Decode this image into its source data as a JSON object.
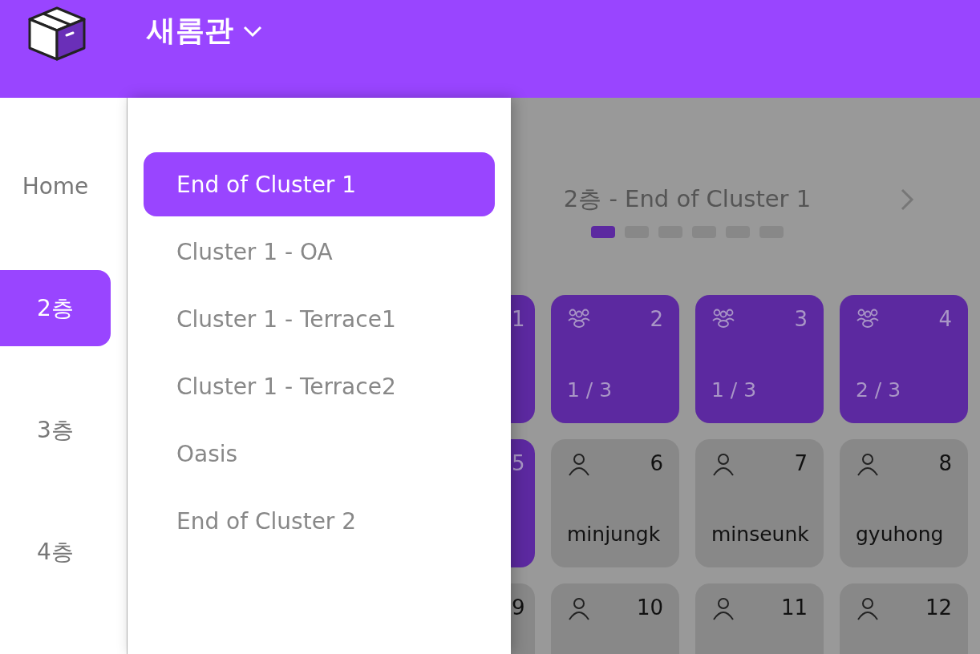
{
  "header": {
    "building": "새롬관"
  },
  "nav": {
    "items": [
      {
        "label": "Home",
        "selected": false
      },
      {
        "label": "2층",
        "selected": true
      },
      {
        "label": "3층",
        "selected": false
      },
      {
        "label": "4층",
        "selected": false
      }
    ]
  },
  "submenu": {
    "items": [
      {
        "label": "End of Cluster 1",
        "selected": true
      },
      {
        "label": "Cluster 1 - OA",
        "selected": false
      },
      {
        "label": "Cluster 1 - Terrace1",
        "selected": false
      },
      {
        "label": "Cluster 1 - Terrace2",
        "selected": false
      },
      {
        "label": "Oasis",
        "selected": false
      },
      {
        "label": "End of Cluster 2",
        "selected": false
      }
    ]
  },
  "page": {
    "title": "2층 - End of Cluster 1",
    "pages": [
      {
        "selected": true
      },
      {
        "selected": false
      },
      {
        "selected": false
      },
      {
        "selected": false
      },
      {
        "selected": false
      },
      {
        "selected": false
      }
    ]
  },
  "seats": [
    {
      "number": "1",
      "kind": "group",
      "partial": true
    },
    {
      "number": "2",
      "kind": "group",
      "partial": false,
      "count": "1 / 3"
    },
    {
      "number": "3",
      "kind": "group",
      "partial": false,
      "count": "1 / 3"
    },
    {
      "number": "4",
      "kind": "group",
      "partial": false,
      "count": "2 / 3"
    },
    {
      "number": "5",
      "kind": "group",
      "partial": true
    },
    {
      "number": "6",
      "kind": "single",
      "partial": false,
      "user": "minjungk"
    },
    {
      "number": "7",
      "kind": "single",
      "partial": false,
      "user": "minseunk"
    },
    {
      "number": "8",
      "kind": "single",
      "partial": false,
      "user": "gyuhong"
    },
    {
      "number": "9",
      "kind": "single",
      "partial": true
    },
    {
      "number": "10",
      "kind": "single",
      "partial": false
    },
    {
      "number": "11",
      "kind": "single",
      "partial": false
    },
    {
      "number": "12",
      "kind": "single",
      "partial": false
    }
  ]
}
